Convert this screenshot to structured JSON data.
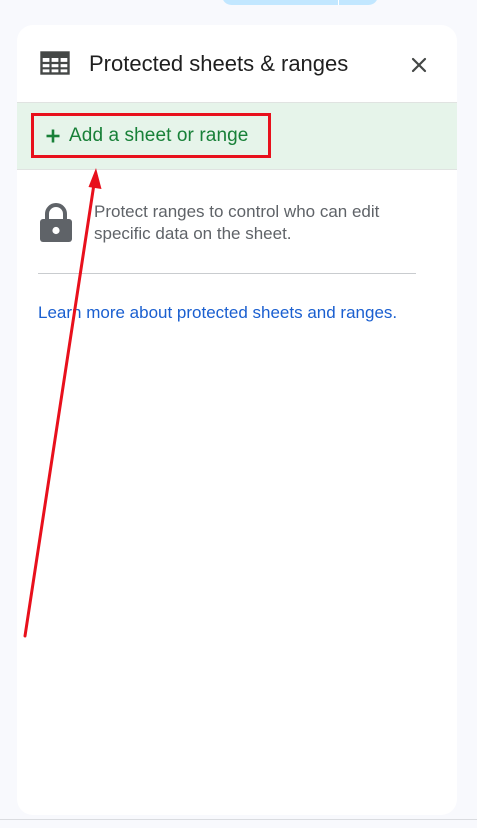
{
  "panel": {
    "title": "Protected sheets & ranges",
    "header_icon": "grid-table-icon",
    "close_icon": "close-icon"
  },
  "add_bar": {
    "label": "Add a sheet or range",
    "icon": "plus-icon"
  },
  "info": {
    "icon": "lock-icon",
    "text": "Protect ranges to control who can edit specific data on the sheet."
  },
  "learn_more": {
    "text": "Learn more about protected sheets and ranges."
  },
  "colors": {
    "add_bar_bg": "#e6f4ea",
    "add_label": "#188038",
    "highlight": "#e8101c",
    "link": "#1a5fd0",
    "icon_grey": "#5f6368"
  }
}
